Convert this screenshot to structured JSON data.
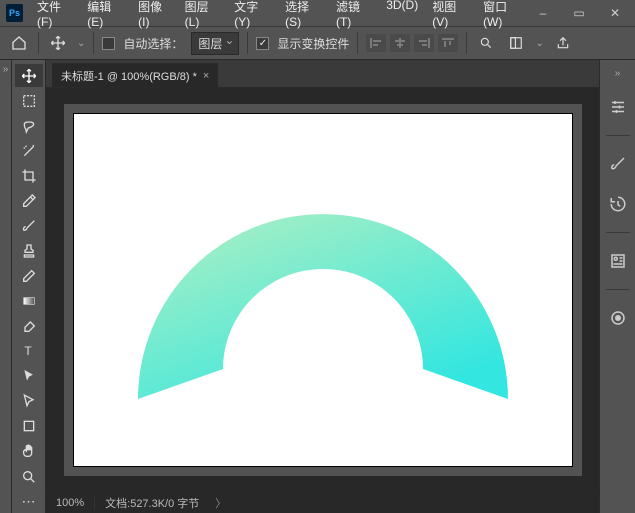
{
  "title": {
    "app_abbrev": "Ps"
  },
  "menu": {
    "file": "文件(F)",
    "edit": "编辑(E)",
    "image": "图像(I)",
    "layer": "图层(L)",
    "type": "文字(Y)",
    "select": "选择(S)",
    "filter": "滤镜(T)",
    "3d": "3D(D)",
    "view": "视图(V)",
    "window": "窗口(W)"
  },
  "window_controls": {
    "minimize": "–",
    "restore": "▭",
    "close": "✕"
  },
  "options": {
    "auto_select_label": "自动选择：",
    "auto_select_value": "图层",
    "show_transform_label": "显示变换控件",
    "show_transform_checked": true,
    "auto_select_checked": false
  },
  "tab": {
    "label": "未标题-1 @ 100%(RGB/8) *",
    "close": "×"
  },
  "status": {
    "zoom": "100%",
    "doc_info": "文档:527.3K/0 字节",
    "chev": "〉"
  },
  "chart_data": {
    "type": "shape",
    "description": "half-arc gradient shape",
    "gradient_start": "#b3f0c1",
    "gradient_end": "#33e6e0",
    "canvas_bg": "#ffffff"
  }
}
